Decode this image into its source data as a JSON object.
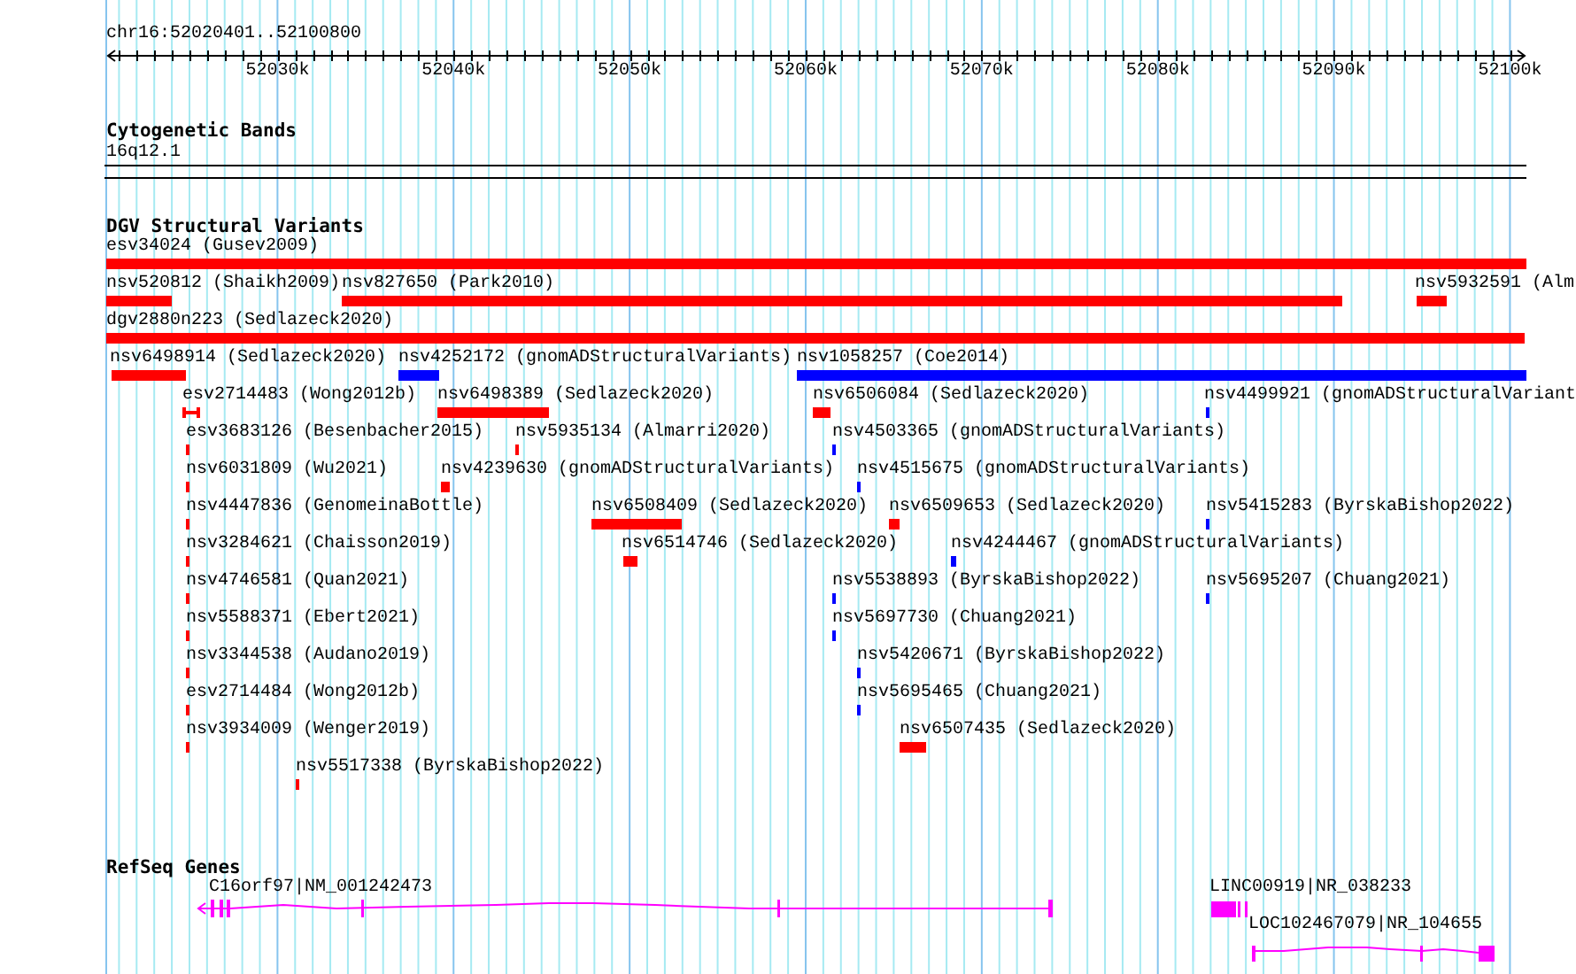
{
  "ruler": {
    "range": "chr16:52020401..52100800",
    "ticks": [
      "52030k",
      "52040k",
      "52050k",
      "52060k",
      "52070k",
      "52080k",
      "52090k",
      "52100k"
    ]
  },
  "tracks": [
    {
      "kind": "bands",
      "title": "Cytogenetic Bands",
      "items": [
        {
          "label": "16q12.1"
        }
      ]
    },
    {
      "kind": "variants",
      "title": "DGV Structural Variants",
      "rows": [
        {
          "features": [
            {
              "label": "esv34024 (Gusev2009)",
              "color": "#ff0000"
            }
          ]
        },
        {
          "features": [
            {
              "label": "nsv520812 (Shaikh2009)",
              "color": "#ff0000"
            },
            {
              "label": "nsv827650 (Park2010)",
              "color": "#ff0000"
            },
            {
              "label": "nsv5932591 (Alm",
              "color": "#ff0000"
            }
          ]
        },
        {
          "features": [
            {
              "label": "dgv2880n223 (Sedlazeck2020)",
              "color": "#ff0000"
            }
          ]
        },
        {
          "features": [
            {
              "label": "nsv6498914 (Sedlazeck2020)",
              "color": "#ff0000"
            },
            {
              "label": "nsv4252172 (gnomADStructuralVariants)",
              "color": "#0000ff"
            },
            {
              "label": "nsv1058257 (Coe2014)",
              "color": "#0000ff"
            }
          ]
        },
        {
          "features": [
            {
              "label": "esv2714483 (Wong2012b)",
              "color": "#ff0000"
            },
            {
              "label": "nsv6498389 (Sedlazeck2020)",
              "color": "#ff0000"
            },
            {
              "label": "nsv6506084 (Sedlazeck2020)",
              "color": "#ff0000"
            },
            {
              "label": "nsv4499921 (gnomADStructuralVariant",
              "color": "#0000ff"
            }
          ]
        },
        {
          "features": [
            {
              "label": "esv3683126 (Besenbacher2015)",
              "color": "#ff0000"
            },
            {
              "label": "nsv5935134 (Almarri2020)",
              "color": "#ff0000"
            },
            {
              "label": "nsv4503365 (gnomADStructuralVariants)",
              "color": "#0000ff"
            }
          ]
        },
        {
          "features": [
            {
              "label": "nsv6031809 (Wu2021)",
              "color": "#ff0000"
            },
            {
              "label": "nsv4239630 (gnomADStructuralVariants)",
              "color": "#ff0000"
            },
            {
              "label": "nsv4515675 (gnomADStructuralVariants)",
              "color": "#0000ff"
            }
          ]
        },
        {
          "features": [
            {
              "label": "nsv4447836 (GenomeinaBottle)",
              "color": "#ff0000"
            },
            {
              "label": "nsv6508409 (Sedlazeck2020)",
              "color": "#ff0000"
            },
            {
              "label": "nsv6509653 (Sedlazeck2020)",
              "color": "#ff0000"
            },
            {
              "label": "nsv5415283 (ByrskaBishop2022)",
              "color": "#0000ff"
            }
          ]
        },
        {
          "features": [
            {
              "label": "nsv3284621 (Chaisson2019)",
              "color": "#ff0000"
            },
            {
              "label": "nsv6514746 (Sedlazeck2020)",
              "color": "#ff0000"
            },
            {
              "label": "nsv4244467 (gnomADStructuralVariants)",
              "color": "#0000ff"
            }
          ]
        },
        {
          "features": [
            {
              "label": "nsv4746581 (Quan2021)",
              "color": "#ff0000"
            },
            {
              "label": "nsv5538893 (ByrskaBishop2022)",
              "color": "#0000ff"
            },
            {
              "label": "nsv5695207 (Chuang2021)",
              "color": "#0000ff"
            }
          ]
        },
        {
          "features": [
            {
              "label": "nsv5588371 (Ebert2021)",
              "color": "#ff0000"
            },
            {
              "label": "nsv5697730 (Chuang2021)",
              "color": "#0000ff"
            }
          ]
        },
        {
          "features": [
            {
              "label": "nsv3344538 (Audano2019)",
              "color": "#ff0000"
            },
            {
              "label": "nsv5420671 (ByrskaBishop2022)",
              "color": "#0000ff"
            }
          ]
        },
        {
          "features": [
            {
              "label": "esv2714484 (Wong2012b)",
              "color": "#ff0000"
            },
            {
              "label": "nsv5695465 (Chuang2021)",
              "color": "#0000ff"
            }
          ]
        },
        {
          "features": [
            {
              "label": "nsv3934009 (Wenger2019)",
              "color": "#ff0000"
            },
            {
              "label": "nsv6507435 (Sedlazeck2020)",
              "color": "#ff0000"
            }
          ]
        },
        {
          "features": [
            {
              "label": "nsv5517338 (ByrskaBishop2022)",
              "color": "#ff0000"
            }
          ]
        }
      ]
    },
    {
      "kind": "genes",
      "title": "RefSeq Genes",
      "items": [
        {
          "label": "C16orf97|NM_001242473"
        },
        {
          "label": "LINC00919|NR_038233"
        },
        {
          "label": "LOC102467079|NR_104655"
        }
      ]
    }
  ]
}
